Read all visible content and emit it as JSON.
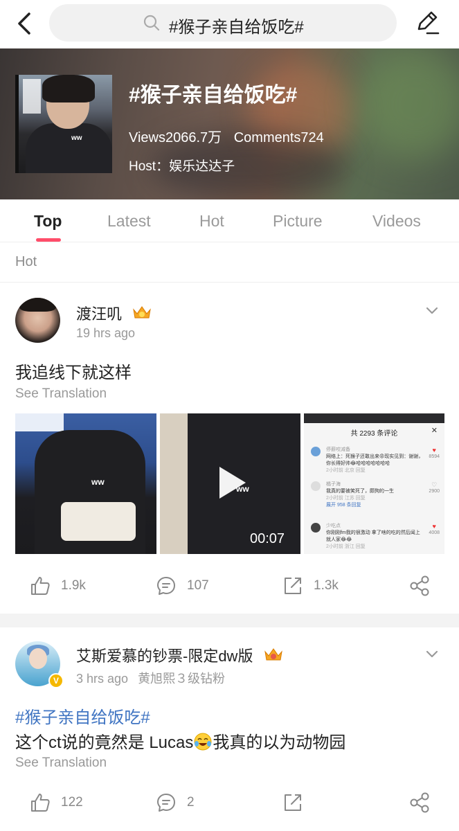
{
  "search": {
    "query": "#猴子亲自给饭吃#"
  },
  "topic": {
    "title": "#猴子亲自给饭吃#",
    "views": "Views2066.7万",
    "comments": "Comments724",
    "host": "Host：娱乐达达子",
    "cover_overlay_text": "ww"
  },
  "tabs": [
    {
      "label": "Top",
      "active": true
    },
    {
      "label": "Latest",
      "active": false
    },
    {
      "label": "Hot",
      "active": false
    },
    {
      "label": "Picture",
      "active": false
    },
    {
      "label": "Videos",
      "active": false
    }
  ],
  "section": {
    "label": "Hot"
  },
  "posts": [
    {
      "username": "渡汪叽",
      "time": "19 hrs ago",
      "text": "我追线下就这样",
      "see_translation": "See Translation",
      "media": {
        "thumb1_watermark": "ww",
        "thumb2_watermark": "ww",
        "thumb2_duration": "00:07",
        "thumb3": {
          "header": "共 2293 条评论",
          "close": "✕",
          "comments": [
            {
              "name": "停薪咬减备",
              "text": "网络上：死猴子还敢出来😡现实见到：谢谢，你长得好帅😂哈哈哈哈哈哈哈",
              "meta": "2小时前 北京 回复",
              "likes": "8594"
            },
            {
              "name": "橘子海",
              "text": "我真的要被笑死了，颇狗的一生",
              "meta": "2小时前 江苏 回复",
              "likes": "2900",
              "extra": "展开 958 条回复"
            },
            {
              "name": "少吃点",
              "text": "你刚刚fm我的很激动 拿了啥的吃的然后闻上就人家😂😂",
              "meta": "2小时前 浙江 回复",
              "likes": "4008"
            }
          ]
        }
      },
      "actions": {
        "likes": "1.9k",
        "comments": "107",
        "shares": "1.3k"
      }
    },
    {
      "username": "艾斯爱慕的钞票-限定dw版",
      "time": "3 hrs ago",
      "extra": "黄旭熙３级钻粉",
      "hashtag": "#猴子亲自给饭吃#",
      "text_before": "这个ct说的竟然是 Lucas",
      "text_after": "我真的以为动物园",
      "see_translation": "See Translation",
      "avatar_badge": "V",
      "actions": {
        "likes": "122",
        "comments": "2",
        "shares": ""
      }
    }
  ],
  "colors": {
    "accent": "#ff4d6a",
    "hashtag": "#3f74c2"
  }
}
